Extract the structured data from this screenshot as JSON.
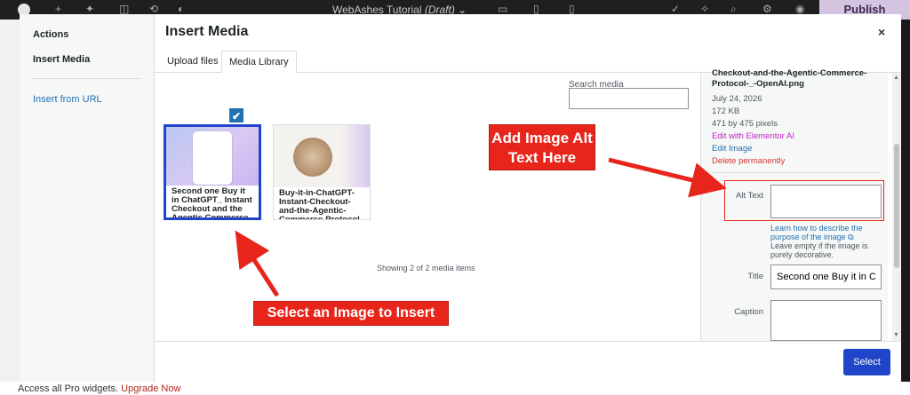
{
  "editor": {
    "doc_title": "WebAshes Tutorial",
    "doc_status": "(Draft)",
    "publish_label": "Publish",
    "promo_text": "Access all Pro widgets.",
    "promo_link": "Upgrade Now"
  },
  "modal": {
    "title": "Insert Media",
    "close_label": "×",
    "menu": {
      "heading": "Actions",
      "active_item": "Insert Media",
      "link_item": "Insert from URL"
    },
    "tabs": [
      {
        "label": "Upload files",
        "active": false
      },
      {
        "label": "Media Library",
        "active": true
      }
    ],
    "search": {
      "label": "Search media",
      "value": ""
    },
    "media_items": [
      {
        "caption": "Second one Buy it in ChatGPT_ Instant Checkout and the Agentic Commerce",
        "selected": true
      },
      {
        "caption": "Buy-it-in-ChatGPT-Instant-Checkout-and-the-Agentic-Commerce-Protocol",
        "selected": false
      }
    ],
    "check_mark": "✔",
    "showing_text": "Showing 2 of 2 media items",
    "details": {
      "filename": "Checkout-and-the-Agentic-Commerce-Protocol-_-OpenAI.png",
      "date": "July 24, 2026",
      "size": "172 KB",
      "dimensions": "471 by 475 pixels",
      "edit_ai": "Edit with Elementor AI",
      "edit_image": "Edit Image",
      "delete": "Delete permanently",
      "alt_label": "Alt Text",
      "alt_value": "",
      "alt_help_link": "Learn how to describe the purpose of the image",
      "alt_help_text": "Leave empty if the image is purely decorative.",
      "title_label": "Title",
      "title_value": "Second one Buy it in C",
      "caption_label": "Caption",
      "caption_value": ""
    },
    "select_button": "Select"
  },
  "annotations": {
    "alt_note": "Add Image Alt Text Here",
    "select_note": "Select an Image to Insert"
  },
  "colors": {
    "accent": "#2145c9",
    "link": "#2271b1",
    "ai_link": "#c024c8",
    "delete": "#d63638",
    "annotation": "#e8251b"
  }
}
